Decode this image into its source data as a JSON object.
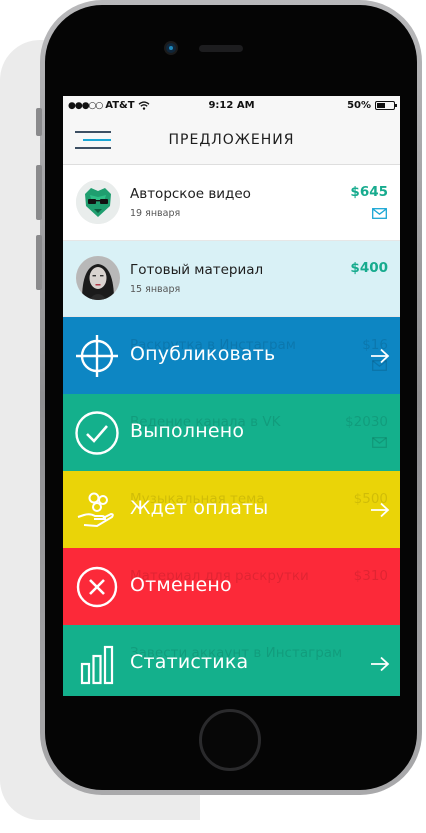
{
  "status_bar": {
    "carrier": "AT&T",
    "time": "9:12 AM",
    "battery": "50%"
  },
  "header": {
    "title": "ПРЕДЛОЖЕНИЯ"
  },
  "offers": [
    {
      "title": "Авторское видео",
      "date": "19 января",
      "price": "$645",
      "icon": "mail-icon"
    },
    {
      "title": "Готовый материал",
      "date": "15 января",
      "price": "$400"
    }
  ],
  "actions": [
    {
      "label": "Опубликовать",
      "icon": "crosshair-icon",
      "color": "#0d86c3",
      "ghost": {
        "title": "Раскрутка в Инстаграм",
        "price": "$16"
      }
    },
    {
      "label": "Выполнено",
      "icon": "checkmark-icon",
      "color": "#14b08c",
      "ghost": {
        "title": "Ведение канала в VK",
        "price": "$2030"
      }
    },
    {
      "label": "Ждет оплаты",
      "icon": "hand-coins-icon",
      "color": "#ead408",
      "ghost": {
        "title": "Музыкальная тема",
        "price": "$500"
      }
    },
    {
      "label": "Отменено",
      "icon": "cancel-icon",
      "color": "#fc2939",
      "ghost": {
        "title": "Материал для раскрутки",
        "price": "$310"
      }
    },
    {
      "label": "Статистика",
      "icon": "bar-chart-icon",
      "color": "#14b08c",
      "ghost": {
        "title": "Завести аккаунт в Инстаграм",
        "price": ""
      }
    }
  ],
  "arrow_icon": "arrow-right-icon",
  "colors": {
    "accent_green": "#17ab8e",
    "selected_row": "#d9f1f6"
  }
}
